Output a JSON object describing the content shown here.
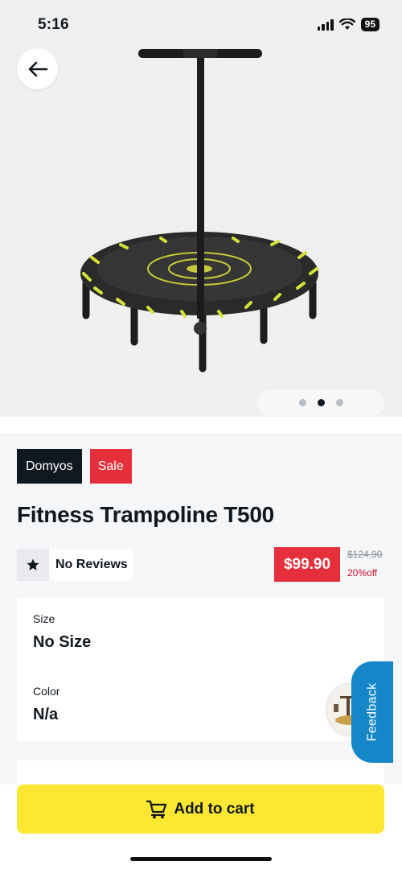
{
  "status_bar": {
    "time": "5:16",
    "battery": "95"
  },
  "gallery": {
    "dots_total": 3,
    "active_dot": 2
  },
  "product": {
    "brand": "Domyos",
    "sale_badge": "Sale",
    "title": "Fitness Trampoline T500",
    "reviews_label": "No Reviews",
    "price": "$99.90",
    "original_price": "$124.90",
    "discount": "20%off"
  },
  "variants": {
    "size_label": "Size",
    "size_value": "No Size",
    "color_label": "Color",
    "color_value": "N/a"
  },
  "feedback_label": "Feedback",
  "cart": {
    "label": "Add to cart"
  },
  "colors": {
    "accent_yellow": "#fde732",
    "sale_red": "#e5303c",
    "brand_dark": "#101820",
    "feedback_blue": "#1586c8"
  }
}
